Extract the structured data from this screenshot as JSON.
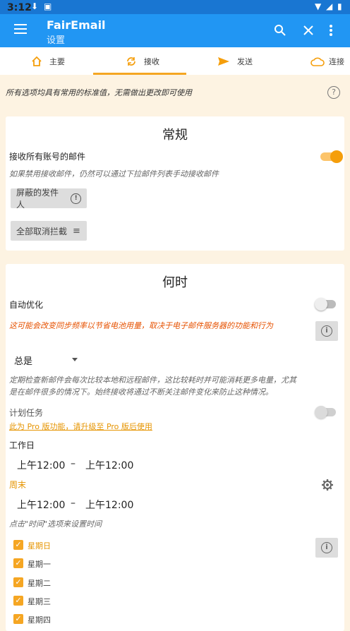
{
  "status": {
    "time": "3:12"
  },
  "app": {
    "title": "FairEmail",
    "subtitle": "设置"
  },
  "tabs": [
    {
      "label": "主要",
      "icon": "home-icon"
    },
    {
      "label": "接收",
      "icon": "sync-icon"
    },
    {
      "label": "发送",
      "icon": "send-icon"
    },
    {
      "label": "连接",
      "icon": "cloud-icon"
    }
  ],
  "hint": "所有选项均具有常用的标准值，无需做出更改即可使用",
  "general": {
    "title": "常规",
    "receive_all_label": "接收所有账号的邮件",
    "receive_all_on": true,
    "receive_all_hint": "如果禁用接收邮件，仍然可以通过下拉邮件列表手动接收邮件",
    "blocked_senders_label": "屏蔽的发件人",
    "unblock_all_label": "全部取消拦截"
  },
  "when": {
    "title": "何时",
    "auto_optimize_label": "自动优化",
    "auto_optimize_on": false,
    "auto_optimize_hint": "这可能会改变同步频率以节省电池用量，取决于电子邮件服务器的功能和行为",
    "frequency_value": "总是",
    "frequency_hint_1": "定期检查新邮件会每次比较本地和远程邮件，这比较耗时并可能消耗更多电量，尤其",
    "frequency_hint_2": "是在邮件很多的情况下。始终接收将通过不断关注邮件变化来防止这种情况。",
    "schedule_label": "计划任务",
    "schedule_on": false,
    "pro_link": "此为 Pro 版功能，请升级至 Pro 版后使用",
    "workdays_label": "工作日",
    "workdays_start": "上午12:00",
    "workdays_end": "上午12:00",
    "dash": "–",
    "weekend_label": "周末",
    "weekend_start": "上午12:00",
    "weekend_end": "上午12:00",
    "time_hint": "点击\"时间\"选项来设置时间",
    "days": [
      {
        "label": "星期日",
        "checked": true
      },
      {
        "label": "星期一",
        "checked": true
      },
      {
        "label": "星期二",
        "checked": true
      },
      {
        "label": "星期三",
        "checked": true
      },
      {
        "label": "星期四",
        "checked": true
      }
    ]
  }
}
